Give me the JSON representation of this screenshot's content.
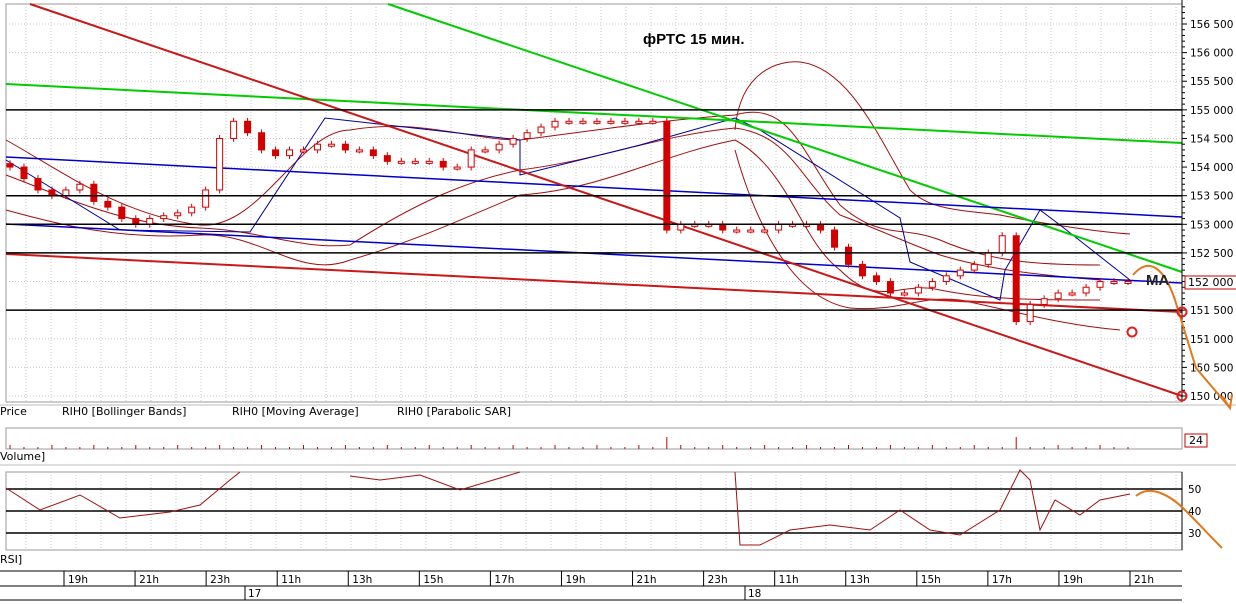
{
  "chart_data": {
    "type": "candlestick",
    "title": "фРТС   15 мин.",
    "instrument": "RIH0",
    "price_axis_ticks": [
      "156 500",
      "156 000",
      "155 500",
      "155 000",
      "154 500",
      "154 000",
      "153 500",
      "153 000",
      "152 500",
      "152 000",
      "151 500",
      "151 000",
      "150 500",
      "150 000"
    ],
    "price_range": [
      149800,
      156800
    ],
    "current_price_label": "152 000",
    "volume_label": "24",
    "rsi_ticks": [
      "50",
      "40",
      "30"
    ],
    "time_ticks": [
      "19h",
      "21h",
      "23h",
      "11h",
      "13h",
      "15h",
      "17h",
      "19h",
      "21h",
      "23h",
      "11h",
      "13h",
      "15h",
      "17h",
      "19h",
      "21h"
    ],
    "date_ticks": [
      "17",
      "18"
    ],
    "legend": [
      {
        "label": "Price",
        "color": "#c00000"
      },
      {
        "label": "RIH0 [Bollinger Bands]",
        "color": "#b22222"
      },
      {
        "label": "RIH0 [Moving Average]",
        "color": "#b22222"
      },
      {
        "label": "RIH0 [Parabolic SAR]",
        "color": "#0000a0"
      }
    ],
    "panel_labels": {
      "volume": "Volume]",
      "rsi": "RSI]"
    },
    "annotation_ma": "MA",
    "horizontal_levels": [
      155000,
      153500,
      153000,
      152500,
      151500
    ],
    "closes": [
      154000,
      153800,
      153600,
      153500,
      153600,
      153700,
      153400,
      153300,
      153100,
      153000,
      153100,
      153150,
      153200,
      153300,
      153600,
      154500,
      154800,
      154600,
      154300,
      154200,
      154300,
      154300,
      154400,
      154400,
      154300,
      154300,
      154200,
      154100,
      154100,
      154100,
      154100,
      154000,
      154000,
      154300,
      154300,
      154400,
      154500,
      154600,
      154700,
      154800,
      154800,
      154800,
      154800,
      154800,
      154800,
      154800,
      154800,
      152900,
      153000,
      153000,
      153000,
      152900,
      152900,
      152900,
      152900,
      153000,
      153000,
      153000,
      152900,
      152600,
      152300,
      152100,
      152000,
      151800,
      151800,
      151900,
      152000,
      152100,
      152200,
      152300,
      152500,
      152800,
      151300,
      151600,
      151700,
      151800,
      151800,
      151900,
      152000,
      152000,
      152000
    ],
    "colors": {
      "candle": "#d40000",
      "bands": "#a01010",
      "sar": "#0000a0",
      "green": "#00cc00",
      "blue_trend": "#0000c8",
      "red_trend": "#c81818",
      "forecast": "#e07820"
    }
  }
}
